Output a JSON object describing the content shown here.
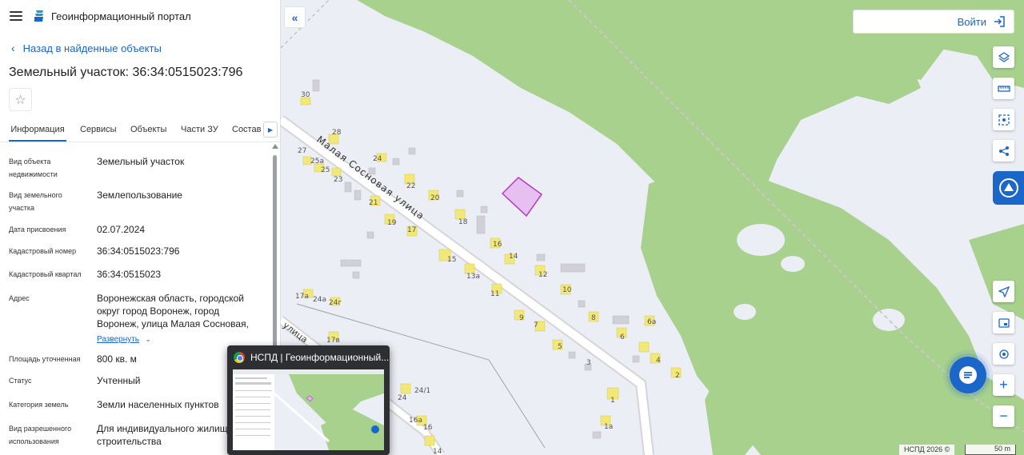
{
  "app": {
    "title": "Геоинформационный портал",
    "menu_icon": "menu-icon",
    "logo_icon": "portal-logo-icon"
  },
  "back_link": {
    "label": "Назад в найденные объекты"
  },
  "object": {
    "title": "Земельный участок: 36:34:0515023:796",
    "favorite_icon": "star-icon"
  },
  "tabs": [
    {
      "label": "Информация",
      "active": true
    },
    {
      "label": "Сервисы"
    },
    {
      "label": "Объекты"
    },
    {
      "label": "Части ЗУ"
    },
    {
      "label": "Состав"
    }
  ],
  "properties": [
    {
      "label": "Вид объекта недвижимости",
      "value": "Земельный участок"
    },
    {
      "label": "Вид земельного участка",
      "value": "Землепользование"
    },
    {
      "label": "Дата присвоения",
      "value": "02.07.2024"
    },
    {
      "label": "Кадастровый номер",
      "value": "36:34:0515023:796"
    },
    {
      "label": "Кадастровый квартал",
      "value": "36:34:0515023"
    },
    {
      "label": "Адрес",
      "value": "Воронежская область, городской округ город Воронеж, город Воронеж, улица Малая Сосновая,",
      "expand": "Развернуть"
    },
    {
      "label": "Площадь уточненная",
      "value": "800 кв. м"
    },
    {
      "label": "Статус",
      "value": "Учтенный"
    },
    {
      "label": "Категория земель",
      "value": "Земли населенных пунктов"
    },
    {
      "label": "Вид разрешенного использования",
      "value": "Для индивидуального жилищного строительства"
    }
  ],
  "map": {
    "login_label": "Войти",
    "street_main": "Малая Сосновая улица",
    "street_side": "улица",
    "copyright": "НСПД 2026 ©",
    "scale": "50 m",
    "house_numbers": [
      "30",
      "28",
      "27",
      "25а",
      "25",
      "23",
      "24",
      "22",
      "20",
      "21",
      "19",
      "17",
      "18",
      "16",
      "15",
      "14",
      "13а",
      "12",
      "11",
      "10",
      "9",
      "8",
      "7",
      "6",
      "6а",
      "5",
      "4",
      "3",
      "2",
      "1",
      "1а",
      "17а",
      "24а",
      "24г",
      "17в",
      "24/1",
      "16а",
      "16",
      "14"
    ],
    "controls": [
      "layers-icon",
      "ruler-icon",
      "select-area-icon",
      "share-icon",
      "cadastre-icon",
      "navigate-icon",
      "map-view-icon",
      "locate-icon",
      "zoom-in-icon",
      "zoom-out-icon"
    ],
    "colors": {
      "forest": "#a9d18e",
      "parcel_fill": "#e6b3f0",
      "parcel_stroke": "#b23ac4",
      "building": "#f2e87a",
      "accent": "#1a66c9"
    }
  },
  "taskbar_preview": {
    "title": "НСПД | Геоинформационный..."
  }
}
